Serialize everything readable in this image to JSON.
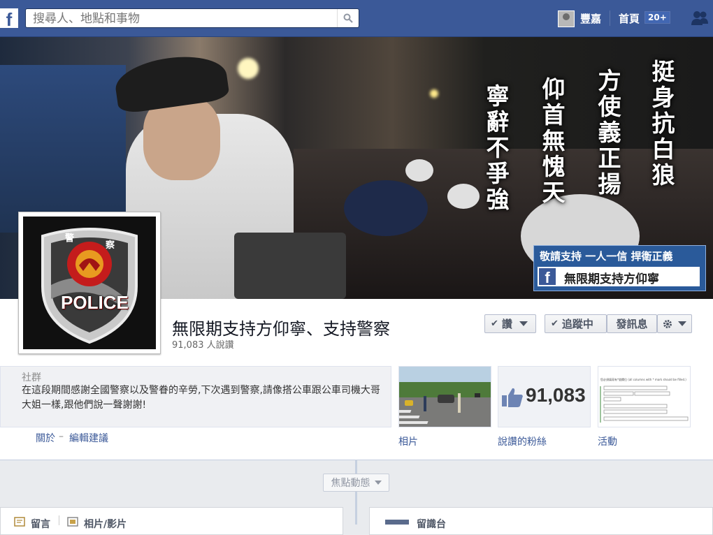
{
  "topbar": {
    "logo": "f",
    "search_placeholder": "搜尋人、地點和事物",
    "user_name": "豐嘉",
    "home_label": "首頁",
    "home_count": "20+"
  },
  "cover": {
    "slogans": [
      "挺身抗白狼",
      "方使義正揚",
      "仰首無愧天",
      "寧辭不爭強"
    ],
    "banner_top": "敬請支持 一人一信 捍衛正義",
    "banner_fb": "f",
    "banner_name": "無限期支持方仰寧"
  },
  "profile": {
    "top_marks": [
      "警",
      "察"
    ],
    "badge_text": "POLICE"
  },
  "page": {
    "title": "無限期支持方仰寧、支持警察",
    "likes": "91,083 人說讚",
    "like_button": "讚",
    "follow_button": "追蹤中",
    "message_button": "發訊息",
    "check": "✔"
  },
  "about": {
    "category": "社群",
    "description": "在這段期間感謝全國警察以及警眷的辛勞,下次遇到警察,請像搭公車跟公車司機大哥大姐一樣,跟他們說一聲謝謝!",
    "about_link": "關於",
    "separator": "–",
    "edit_link": "編輯建議"
  },
  "apps": {
    "photos_label": "相片",
    "fans_count": "91,083",
    "fans_label": "說讚的粉絲",
    "events_label": "活動",
    "events_form_text": "您必須填寫有*號欄位 (all columns with * mark should be filled.)"
  },
  "timeline": {
    "highlights": "焦點動態",
    "left_tab1": "留言",
    "left_tab2": "相片/影片",
    "right_tab": "留識台"
  },
  "colors": {
    "brand": "#3b5998",
    "banner": "#2a5a9a"
  }
}
